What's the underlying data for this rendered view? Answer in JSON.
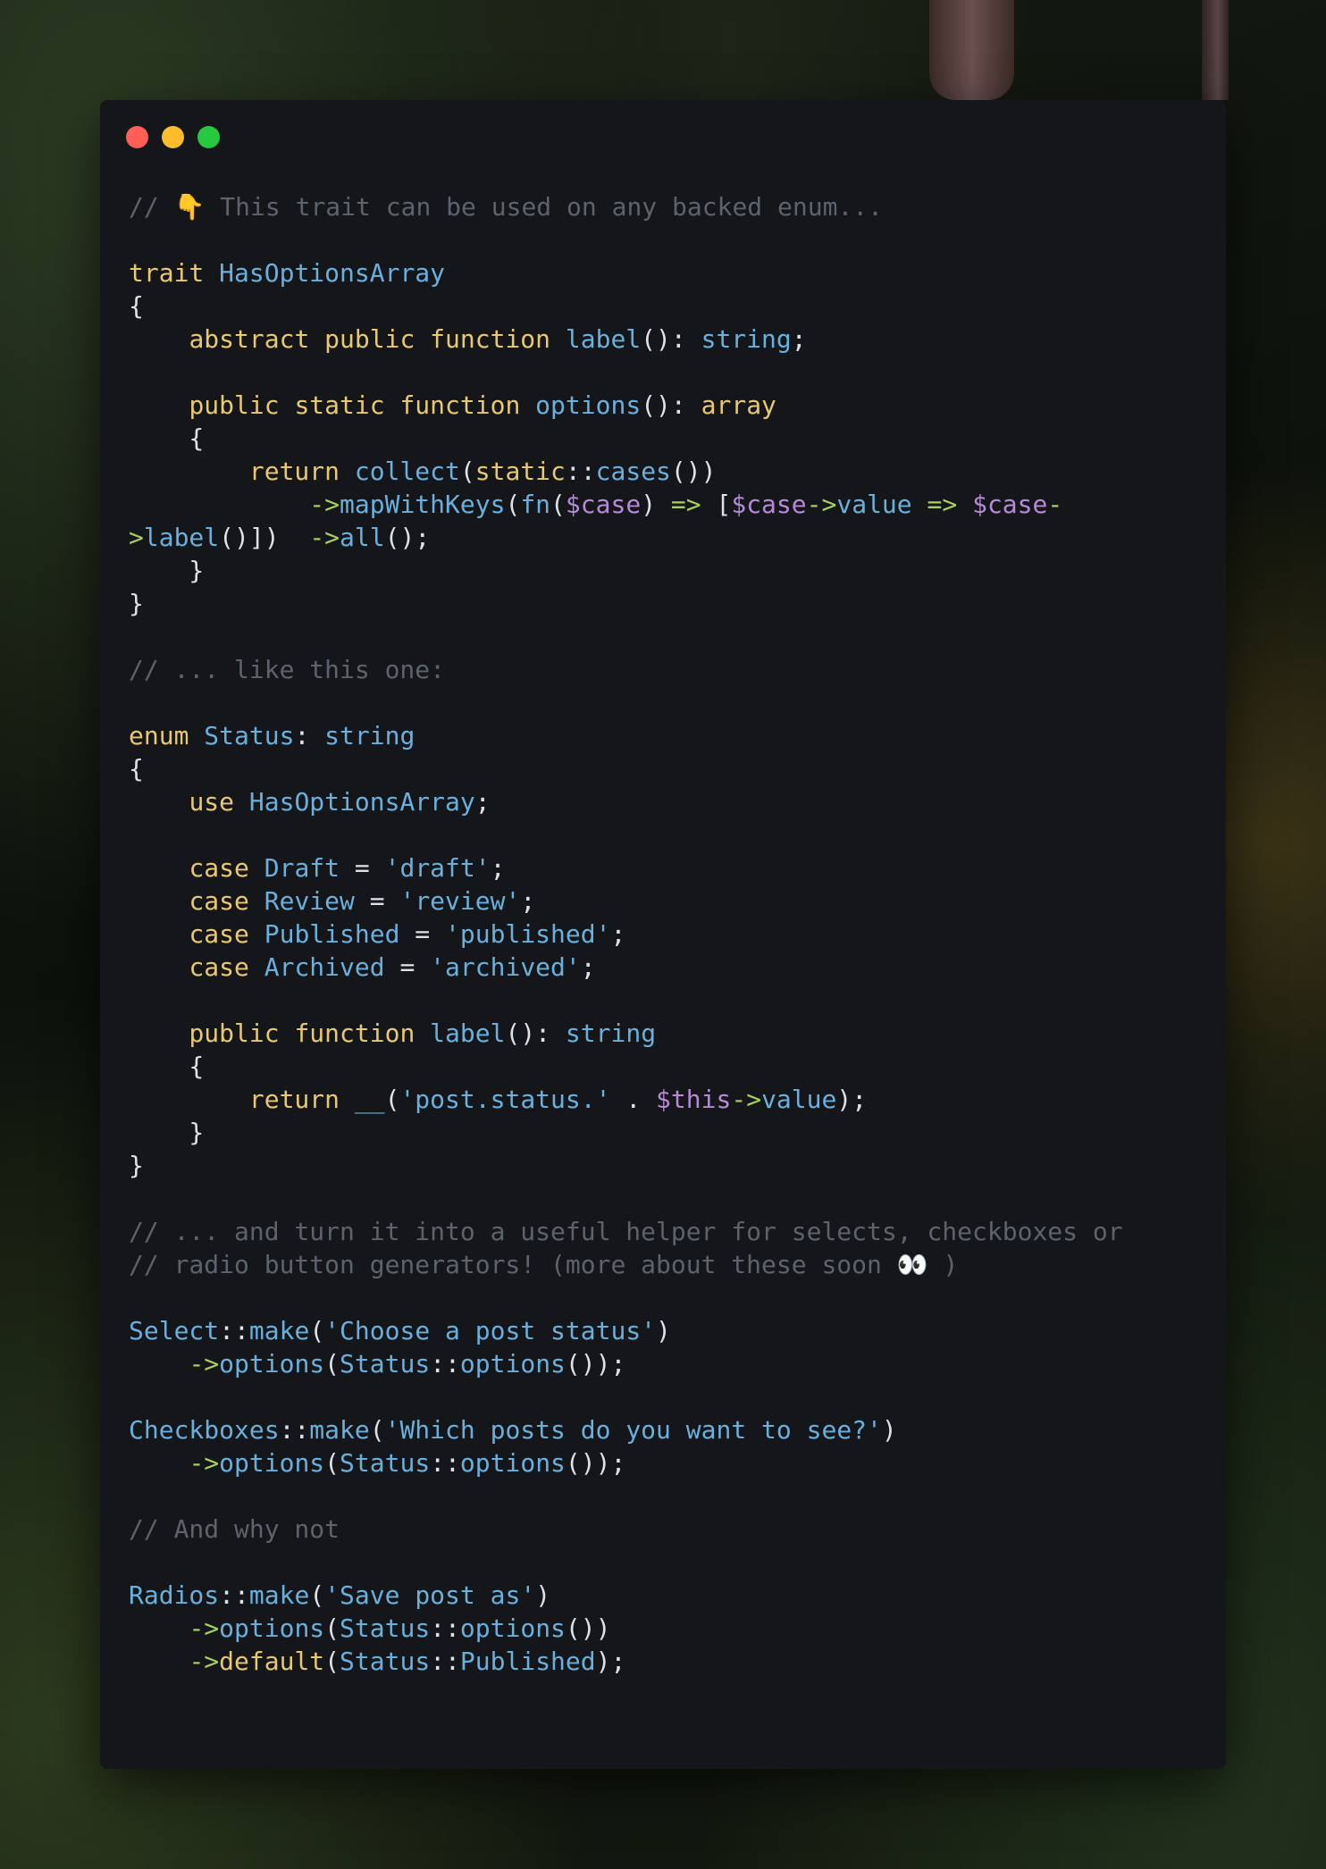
{
  "window": {
    "controls": [
      "close",
      "minimize",
      "maximize"
    ]
  },
  "code": {
    "lines": [
      [
        [
          "co",
          "// 👇 This trait can be used on any backed enum..."
        ]
      ],
      [],
      [
        [
          "kw",
          "trait"
        ],
        [
          "pl",
          " "
        ],
        [
          "fn",
          "HasOptionsArray"
        ]
      ],
      [
        [
          "pl",
          "{"
        ]
      ],
      [
        [
          "pl",
          "    "
        ],
        [
          "kw",
          "abstract public function"
        ],
        [
          "pl",
          " "
        ],
        [
          "fn",
          "label"
        ],
        [
          "pl",
          "(): "
        ],
        [
          "fn",
          "string"
        ],
        [
          "pl",
          ";"
        ]
      ],
      [],
      [
        [
          "pl",
          "    "
        ],
        [
          "kw",
          "public static function"
        ],
        [
          "pl",
          " "
        ],
        [
          "fn",
          "options"
        ],
        [
          "pl",
          "(): "
        ],
        [
          "kw",
          "array"
        ]
      ],
      [
        [
          "pl",
          "    {"
        ]
      ],
      [
        [
          "pl",
          "        "
        ],
        [
          "kw",
          "return"
        ],
        [
          "pl",
          " "
        ],
        [
          "fn",
          "collect"
        ],
        [
          "pl",
          "("
        ],
        [
          "kw",
          "static"
        ],
        [
          "pl",
          "::"
        ],
        [
          "fn",
          "cases"
        ],
        [
          "pl",
          "())"
        ]
      ],
      [
        [
          "pl",
          "            "
        ],
        [
          "ar",
          "->"
        ],
        [
          "fn",
          "mapWithKeys"
        ],
        [
          "pl",
          "("
        ],
        [
          "fn",
          "fn"
        ],
        [
          "pl",
          "("
        ],
        [
          "va",
          "$case"
        ],
        [
          "pl",
          ") "
        ],
        [
          "ar",
          "=>"
        ],
        [
          "pl",
          " ["
        ],
        [
          "va",
          "$case"
        ],
        [
          "ar",
          "->"
        ],
        [
          "fn",
          "value"
        ],
        [
          "pl",
          " "
        ],
        [
          "ar",
          "=>"
        ],
        [
          "pl",
          " "
        ],
        [
          "va",
          "$case"
        ],
        [
          "ar",
          "-"
        ]
      ],
      [
        [
          "ar",
          ">"
        ],
        [
          "fn",
          "label"
        ],
        [
          "pl",
          "()])  "
        ],
        [
          "ar",
          "->"
        ],
        [
          "fn",
          "all"
        ],
        [
          "pl",
          "();"
        ]
      ],
      [
        [
          "pl",
          "    }"
        ]
      ],
      [
        [
          "pl",
          "}"
        ]
      ],
      [],
      [
        [
          "co",
          "// ... like this one:"
        ]
      ],
      [],
      [
        [
          "kw",
          "enum"
        ],
        [
          "pl",
          " "
        ],
        [
          "fn",
          "Status"
        ],
        [
          "pl",
          ": "
        ],
        [
          "fn",
          "string"
        ]
      ],
      [
        [
          "pl",
          "{"
        ]
      ],
      [
        [
          "pl",
          "    "
        ],
        [
          "kw",
          "use"
        ],
        [
          "pl",
          " "
        ],
        [
          "fn",
          "HasOptionsArray"
        ],
        [
          "pl",
          ";"
        ]
      ],
      [],
      [
        [
          "pl",
          "    "
        ],
        [
          "kw",
          "case"
        ],
        [
          "pl",
          " "
        ],
        [
          "fn",
          "Draft"
        ],
        [
          "pl",
          " = "
        ],
        [
          "fn",
          "'draft'"
        ],
        [
          "pl",
          ";"
        ]
      ],
      [
        [
          "pl",
          "    "
        ],
        [
          "kw",
          "case"
        ],
        [
          "pl",
          " "
        ],
        [
          "fn",
          "Review"
        ],
        [
          "pl",
          " = "
        ],
        [
          "fn",
          "'review'"
        ],
        [
          "pl",
          ";"
        ]
      ],
      [
        [
          "pl",
          "    "
        ],
        [
          "kw",
          "case"
        ],
        [
          "pl",
          " "
        ],
        [
          "fn",
          "Published"
        ],
        [
          "pl",
          " = "
        ],
        [
          "fn",
          "'published'"
        ],
        [
          "pl",
          ";"
        ]
      ],
      [
        [
          "pl",
          "    "
        ],
        [
          "kw",
          "case"
        ],
        [
          "pl",
          " "
        ],
        [
          "fn",
          "Archived"
        ],
        [
          "pl",
          " = "
        ],
        [
          "fn",
          "'archived'"
        ],
        [
          "pl",
          ";"
        ]
      ],
      [],
      [
        [
          "pl",
          "    "
        ],
        [
          "kw",
          "public function"
        ],
        [
          "pl",
          " "
        ],
        [
          "fn",
          "label"
        ],
        [
          "pl",
          "(): "
        ],
        [
          "fn",
          "string"
        ]
      ],
      [
        [
          "pl",
          "    {"
        ]
      ],
      [
        [
          "pl",
          "        "
        ],
        [
          "kw",
          "return"
        ],
        [
          "pl",
          " "
        ],
        [
          "fn",
          "__"
        ],
        [
          "pl",
          "("
        ],
        [
          "fn",
          "'post.status.'"
        ],
        [
          "pl",
          " . "
        ],
        [
          "va",
          "$this"
        ],
        [
          "ar",
          "->"
        ],
        [
          "fn",
          "value"
        ],
        [
          "pl",
          ");"
        ]
      ],
      [
        [
          "pl",
          "    }"
        ]
      ],
      [
        [
          "pl",
          "}"
        ]
      ],
      [],
      [
        [
          "co",
          "// ... and turn it into a useful helper for selects, checkboxes or"
        ]
      ],
      [
        [
          "co",
          "// radio button generators! (more about these soon 👀 )"
        ]
      ],
      [],
      [
        [
          "fn",
          "Select"
        ],
        [
          "pl",
          "::"
        ],
        [
          "fn",
          "make"
        ],
        [
          "pl",
          "("
        ],
        [
          "fn",
          "'Choose a post status'"
        ],
        [
          "pl",
          ")"
        ]
      ],
      [
        [
          "pl",
          "    "
        ],
        [
          "ar",
          "->"
        ],
        [
          "fn",
          "options"
        ],
        [
          "pl",
          "("
        ],
        [
          "fn",
          "Status"
        ],
        [
          "pl",
          "::"
        ],
        [
          "fn",
          "options"
        ],
        [
          "pl",
          "());"
        ]
      ],
      [],
      [
        [
          "fn",
          "Checkboxes"
        ],
        [
          "pl",
          "::"
        ],
        [
          "fn",
          "make"
        ],
        [
          "pl",
          "("
        ],
        [
          "fn",
          "'Which posts do you want to see?'"
        ],
        [
          "pl",
          ")"
        ]
      ],
      [
        [
          "pl",
          "    "
        ],
        [
          "ar",
          "->"
        ],
        [
          "fn",
          "options"
        ],
        [
          "pl",
          "("
        ],
        [
          "fn",
          "Status"
        ],
        [
          "pl",
          "::"
        ],
        [
          "fn",
          "options"
        ],
        [
          "pl",
          "());"
        ]
      ],
      [],
      [
        [
          "co",
          "// And why not"
        ]
      ],
      [],
      [
        [
          "fn",
          "Radios"
        ],
        [
          "pl",
          "::"
        ],
        [
          "fn",
          "make"
        ],
        [
          "pl",
          "("
        ],
        [
          "fn",
          "'Save post as'"
        ],
        [
          "pl",
          ")"
        ]
      ],
      [
        [
          "pl",
          "    "
        ],
        [
          "ar",
          "->"
        ],
        [
          "fn",
          "options"
        ],
        [
          "pl",
          "("
        ],
        [
          "fn",
          "Status"
        ],
        [
          "pl",
          "::"
        ],
        [
          "fn",
          "options"
        ],
        [
          "pl",
          "())"
        ]
      ],
      [
        [
          "pl",
          "    "
        ],
        [
          "ar",
          "->"
        ],
        [
          "kw",
          "default"
        ],
        [
          "pl",
          "("
        ],
        [
          "fn",
          "Status"
        ],
        [
          "pl",
          "::"
        ],
        [
          "fn",
          "Published"
        ],
        [
          "pl",
          ");"
        ]
      ]
    ]
  }
}
